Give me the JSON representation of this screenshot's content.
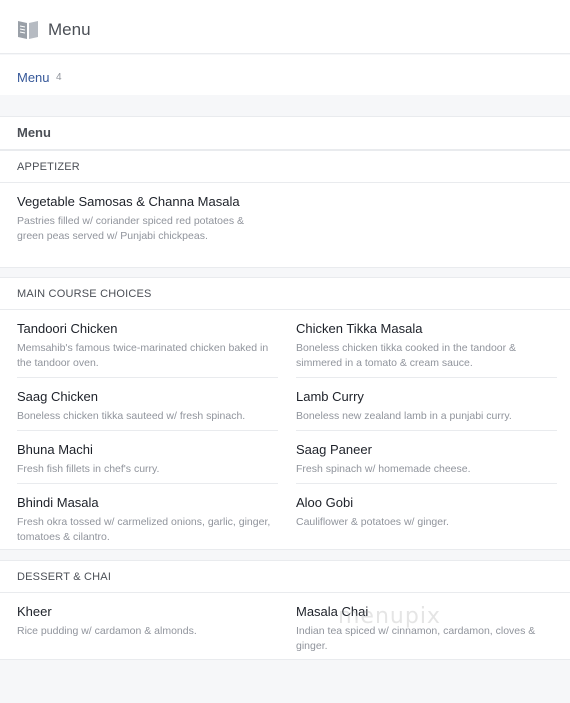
{
  "header": {
    "title": "Menu",
    "icon": "book-icon"
  },
  "tabs": {
    "label": "Menu",
    "count": "4"
  },
  "menu_heading": "Menu",
  "sections": {
    "appetizer": {
      "title": "APPETIZER",
      "items": [
        {
          "name": "Vegetable Samosas & Channa Masala",
          "desc": "Pastries filled w/ coriander spiced red potatoes & green peas served w/ Punjabi chickpeas."
        }
      ]
    },
    "main": {
      "title": "MAIN COURSE CHOICES",
      "items": [
        {
          "name": "Tandoori Chicken",
          "desc": "Memsahib's famous twice-marinated chicken baked in the tandoor oven."
        },
        {
          "name": "Chicken Tikka Masala",
          "desc": "Boneless chicken tikka cooked in the tandoor & simmered in a tomato & cream sauce."
        },
        {
          "name": "Saag Chicken",
          "desc": "Boneless chicken tikka sauteed w/ fresh spinach."
        },
        {
          "name": "Lamb Curry",
          "desc": "Boneless new zealand lamb in a punjabi curry."
        },
        {
          "name": "Bhuna Machi",
          "desc": "Fresh fish fillets in chef's curry."
        },
        {
          "name": "Saag Paneer",
          "desc": "Fresh spinach w/ homemade cheese."
        },
        {
          "name": "Bhindi Masala",
          "desc": "Fresh okra tossed w/ carmelized onions, garlic, ginger, tomatoes & cilantro."
        },
        {
          "name": "Aloo Gobi",
          "desc": "Cauliflower & potatoes w/ ginger."
        }
      ]
    },
    "dessert": {
      "title": "DESSERT & CHAI",
      "items": [
        {
          "name": "Kheer",
          "desc": "Rice pudding w/ cardamon & almonds."
        },
        {
          "name": "Masala Chai",
          "desc": "Indian tea spiced w/ cinnamon, cardamon, cloves & ginger."
        }
      ]
    }
  },
  "watermark": "menupix",
  "colors": {
    "link": "#365899",
    "muted": "#90949c",
    "border": "#e9ebee",
    "background": "#f6f7f9"
  }
}
